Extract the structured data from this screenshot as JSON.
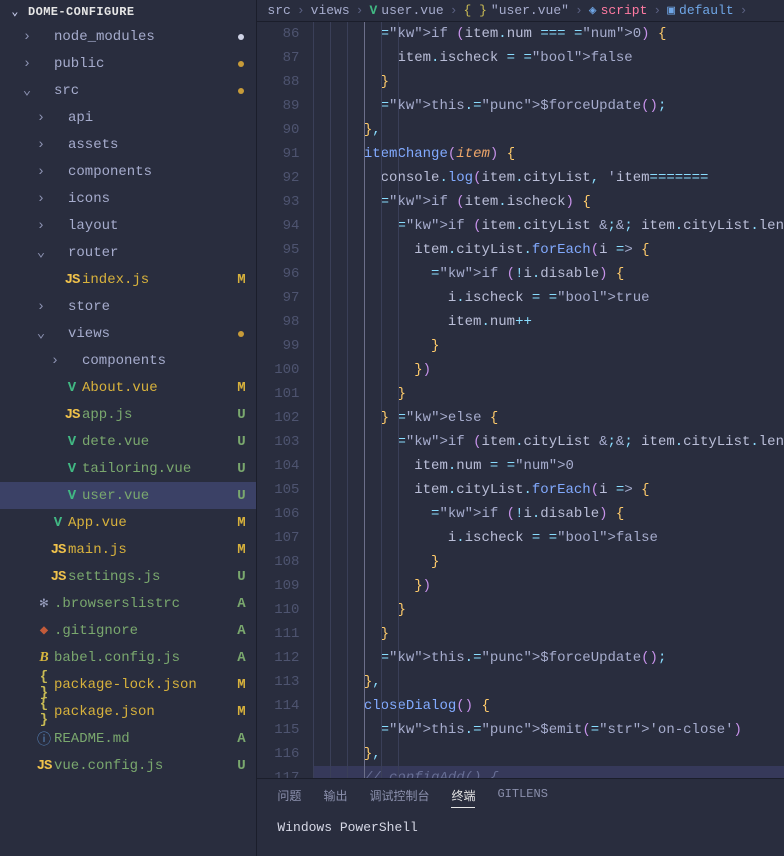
{
  "explorer": {
    "title": "DOME-CONFIGURE",
    "items": [
      {
        "kind": "folder",
        "depth": 1,
        "open": false,
        "name": "node_modules",
        "dot": "white"
      },
      {
        "kind": "folder",
        "depth": 1,
        "open": false,
        "name": "public",
        "dot": "yellow"
      },
      {
        "kind": "folder",
        "depth": 1,
        "open": true,
        "name": "src",
        "dot": "yellow"
      },
      {
        "kind": "folder",
        "depth": 2,
        "open": false,
        "name": "api"
      },
      {
        "kind": "folder",
        "depth": 2,
        "open": false,
        "name": "assets"
      },
      {
        "kind": "folder",
        "depth": 2,
        "open": false,
        "name": "components"
      },
      {
        "kind": "folder",
        "depth": 2,
        "open": false,
        "name": "icons"
      },
      {
        "kind": "folder",
        "depth": 2,
        "open": false,
        "name": "layout"
      },
      {
        "kind": "folder",
        "depth": 2,
        "open": true,
        "name": "router"
      },
      {
        "kind": "file",
        "depth": 3,
        "icon": "js",
        "name": "index.js",
        "status": "M"
      },
      {
        "kind": "folder",
        "depth": 2,
        "open": false,
        "name": "store"
      },
      {
        "kind": "folder",
        "depth": 2,
        "open": true,
        "name": "views",
        "dot": "yellow"
      },
      {
        "kind": "folder",
        "depth": 3,
        "open": false,
        "name": "components"
      },
      {
        "kind": "file",
        "depth": 3,
        "icon": "vue",
        "name": "About.vue",
        "status": "M"
      },
      {
        "kind": "file",
        "depth": 3,
        "icon": "js",
        "name": "app.js",
        "status": "U"
      },
      {
        "kind": "file",
        "depth": 3,
        "icon": "vue",
        "name": "dete.vue",
        "status": "U"
      },
      {
        "kind": "file",
        "depth": 3,
        "icon": "vue",
        "name": "tailoring.vue",
        "status": "U"
      },
      {
        "kind": "file",
        "depth": 3,
        "icon": "vue",
        "name": "user.vue",
        "status": "U",
        "active": true
      },
      {
        "kind": "file",
        "depth": 2,
        "icon": "vue",
        "name": "App.vue",
        "status": "M"
      },
      {
        "kind": "file",
        "depth": 2,
        "icon": "js",
        "name": "main.js",
        "status": "M"
      },
      {
        "kind": "file",
        "depth": 2,
        "icon": "js",
        "name": "settings.js",
        "status": "U"
      },
      {
        "kind": "file",
        "depth": 1,
        "icon": "gear",
        "name": ".browserslistrc",
        "status": "A"
      },
      {
        "kind": "file",
        "depth": 1,
        "icon": "git",
        "name": ".gitignore",
        "status": "A"
      },
      {
        "kind": "file",
        "depth": 1,
        "icon": "babel",
        "name": "babel.config.js",
        "status": "A"
      },
      {
        "kind": "file",
        "depth": 1,
        "icon": "braces",
        "name": "package-lock.json",
        "status": "M"
      },
      {
        "kind": "file",
        "depth": 1,
        "icon": "braces",
        "name": "package.json",
        "status": "M"
      },
      {
        "kind": "file",
        "depth": 1,
        "icon": "info",
        "name": "README.md",
        "status": "A"
      },
      {
        "kind": "file",
        "depth": 1,
        "icon": "js",
        "name": "vue.config.js",
        "status": "U"
      }
    ]
  },
  "breadcrumb": {
    "parts": [
      {
        "text": "src",
        "cls": "bc-file"
      },
      {
        "text": "views",
        "cls": "bc-file"
      },
      {
        "text": "user.vue",
        "cls": "bc-file",
        "icon": "vue"
      },
      {
        "text": "\"user.vue\"",
        "cls": "bc-file",
        "icon": "braces"
      },
      {
        "text": "script",
        "cls": "bc-script",
        "icon": "script"
      },
      {
        "text": "default",
        "cls": "bc-default",
        "icon": "default"
      }
    ]
  },
  "editor": {
    "first_line": 86,
    "lines": [
      "        if (item.num === 0) {",
      "          item.ischeck = false",
      "        }",
      "        this.$forceUpdate();",
      "      },",
      "      itemChange(item) {",
      "        console.log(item.cityList, 'item=======",
      "        if (item.ischeck) {",
      "          if (item.cityList && item.cityList.len",
      "            item.cityList.forEach(i => {",
      "              if (!i.disable) {",
      "                i.ischeck = true",
      "                item.num++",
      "              }",
      "            })",
      "          }",
      "        } else {",
      "          if (item.cityList && item.cityList.len",
      "            item.num = 0",
      "            item.cityList.forEach(i => {",
      "              if (!i.disable) {",
      "                i.ischeck = false",
      "              }",
      "            })",
      "          }",
      "        }",
      "        this.$forceUpdate();",
      "      },",
      "      closeDialog() {",
      "        this.$emit('on-close')",
      "      },",
      "      // configAdd() {"
    ]
  },
  "panel": {
    "tabs": [
      "问题",
      "输出",
      "调试控制台",
      "终端",
      "GITLENS"
    ],
    "active": 3,
    "body": "Windows PowerShell"
  }
}
